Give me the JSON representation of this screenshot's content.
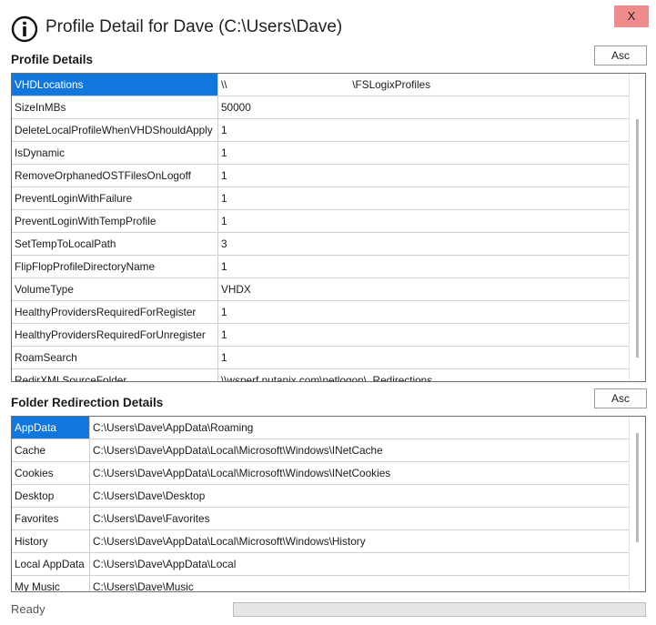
{
  "window": {
    "title": "Profile Detail for Dave (C:\\Users\\Dave)",
    "close_label": "X"
  },
  "profile": {
    "heading": "Profile Details",
    "sort_label": "Asc",
    "rows": [
      {
        "key": "VHDLocations",
        "value": "\\\\                                          \\FSLogixProfiles",
        "selected": true
      },
      {
        "key": "SizeInMBs",
        "value": "50000"
      },
      {
        "key": "DeleteLocalProfileWhenVHDShouldApply",
        "value": "1"
      },
      {
        "key": "IsDynamic",
        "value": "1"
      },
      {
        "key": "RemoveOrphanedOSTFilesOnLogoff",
        "value": "1"
      },
      {
        "key": "PreventLoginWithFailure",
        "value": "1"
      },
      {
        "key": "PreventLoginWithTempProfile",
        "value": "1"
      },
      {
        "key": "SetTempToLocalPath",
        "value": "3"
      },
      {
        "key": "FlipFlopProfileDirectoryName",
        "value": "1"
      },
      {
        "key": "VolumeType",
        "value": "VHDX"
      },
      {
        "key": "HealthyProvidersRequiredForRegister",
        "value": "1"
      },
      {
        "key": "HealthyProvidersRequiredForUnregister",
        "value": "1"
      },
      {
        "key": "RoamSearch",
        "value": "1"
      },
      {
        "key": "RedirXMLSourceFolder",
        "value": "\\\\wsperf.nutanix.com\\netlogon\\_Redirections"
      }
    ]
  },
  "folders": {
    "heading": "Folder Redirection Details",
    "sort_label": "Asc",
    "rows": [
      {
        "key": "AppData",
        "value": "C:\\Users\\Dave\\AppData\\Roaming",
        "selected": true
      },
      {
        "key": "Cache",
        "value": "C:\\Users\\Dave\\AppData\\Local\\Microsoft\\Windows\\INetCache"
      },
      {
        "key": "Cookies",
        "value": "C:\\Users\\Dave\\AppData\\Local\\Microsoft\\Windows\\INetCookies"
      },
      {
        "key": "Desktop",
        "value": "C:\\Users\\Dave\\Desktop"
      },
      {
        "key": "Favorites",
        "value": "C:\\Users\\Dave\\Favorites"
      },
      {
        "key": "History",
        "value": "C:\\Users\\Dave\\AppData\\Local\\Microsoft\\Windows\\History"
      },
      {
        "key": "Local AppData",
        "value": "C:\\Users\\Dave\\AppData\\Local"
      },
      {
        "key": "My Music",
        "value": "C:\\Users\\Dave\\Music"
      }
    ]
  },
  "status": {
    "text": "Ready",
    "progress": 0
  },
  "icons": {
    "title_icon": "info-icon",
    "close": "close-icon"
  }
}
